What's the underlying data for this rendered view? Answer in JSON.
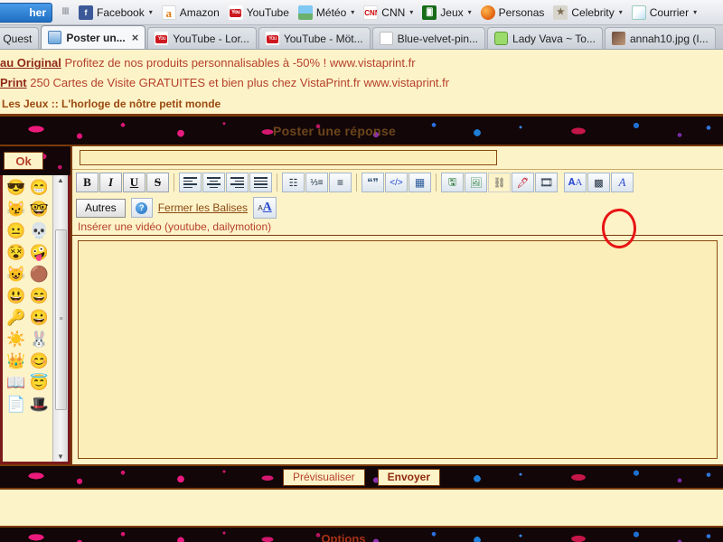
{
  "browser": {
    "bookmarks": [
      {
        "label": "her",
        "icon": "search-stub-icon",
        "has_caret": false
      },
      {
        "label": "Facebook",
        "icon": "facebook-icon",
        "glyph": "f",
        "has_caret": true
      },
      {
        "label": "Amazon",
        "icon": "amazon-icon",
        "glyph": "a",
        "has_caret": false
      },
      {
        "label": "YouTube",
        "icon": "youtube-icon",
        "glyph": "You",
        "has_caret": false
      },
      {
        "label": "Météo",
        "icon": "weather-icon",
        "glyph": "",
        "has_caret": true
      },
      {
        "label": "CNN",
        "icon": "cnn-icon",
        "glyph": "CNN",
        "has_caret": true
      },
      {
        "label": "Jeux",
        "icon": "games-icon",
        "glyph": "",
        "has_caret": true
      },
      {
        "label": "Personas",
        "icon": "firefox-icon",
        "glyph": "",
        "has_caret": false
      },
      {
        "label": "Celebrity",
        "icon": "star-icon",
        "glyph": "★",
        "has_caret": true
      },
      {
        "label": "Courrier",
        "icon": "mail-icon",
        "glyph": "",
        "has_caret": true
      }
    ],
    "tabs": [
      {
        "title": "ev - Quest",
        "icon": "page-icon",
        "active": false,
        "closable": false
      },
      {
        "title": "Poster un...",
        "icon": "monitor-icon",
        "active": true,
        "closable": true,
        "close_glyph": "×"
      },
      {
        "title": "YouTube - Lor...",
        "icon": "youtube-icon",
        "active": false,
        "closable": false
      },
      {
        "title": "YouTube - Möt...",
        "icon": "youtube-icon",
        "active": false,
        "closable": false
      },
      {
        "title": "Blue-velvet-pin...",
        "icon": "document-icon",
        "active": false,
        "closable": false
      },
      {
        "title": "Lady Vava ~ To...",
        "icon": "chat-icon",
        "active": false,
        "closable": false
      },
      {
        "title": "annah10.jpg (I...",
        "icon": "photo-icon",
        "active": false,
        "closable": false
      }
    ]
  },
  "ads": [
    {
      "strong": "au Original",
      "text": " Profitez de nos produits personnalisables à -50% !",
      "url": "www.vistaprint.fr"
    },
    {
      "strong": "Print",
      "text": " 250 Cartes de Visite GRATUITES et bien plus chez VistaPrint.fr",
      "url": "www.vistaprint.fr"
    }
  ],
  "breadcrumb": "Les Jeux :: L'horloge de nôtre petit monde",
  "page_header": "Poster une réponse",
  "smiley_panel": {
    "ok_button": "Ok",
    "smileys": [
      "😎",
      "😁",
      "😼",
      "🤓",
      "😐",
      "💀",
      "😵",
      "🤪",
      "😺",
      "🟤",
      "😃",
      "😄",
      "🔑",
      "😀",
      "☀️",
      "🐰",
      "👑",
      "😊",
      "📖",
      "😇",
      "📄",
      "🎩"
    ],
    "scroll_up": "▲",
    "scroll_down": "▼",
    "scroll_grip": "≡"
  },
  "editor": {
    "subject_value": "",
    "subject_placeholder": "",
    "message_value": "",
    "message_placeholder": "",
    "status_hint": "Insérer une vidéo (youtube, dailymotion)",
    "toolbar_row1": [
      {
        "name": "bold-button",
        "label": "B",
        "style": "plain-bold"
      },
      {
        "name": "italic-button",
        "label": "I",
        "style": "plain-italic"
      },
      {
        "name": "underline-button",
        "label": "U",
        "style": "plain-underline"
      },
      {
        "name": "strikethrough-button",
        "label": "S",
        "style": "plain-strike"
      },
      {
        "name": "separator-1",
        "label": "",
        "style": "sep"
      },
      {
        "name": "align-left-button",
        "label": "",
        "style": "align-left"
      },
      {
        "name": "align-center-button",
        "label": "",
        "style": "align-center"
      },
      {
        "name": "align-right-button",
        "label": "",
        "style": "align-right"
      },
      {
        "name": "align-justify-button",
        "label": "",
        "style": "align-justify"
      },
      {
        "name": "separator-2",
        "label": "",
        "style": "sep"
      },
      {
        "name": "bullet-list-button",
        "label": "☰",
        "style": "icon-list-bullet"
      },
      {
        "name": "numbered-list-button",
        "label": "☰",
        "style": "icon-list-number"
      },
      {
        "name": "indent-button",
        "label": "≡",
        "style": "icon-indent"
      },
      {
        "name": "separator-3",
        "label": "",
        "style": "sep"
      },
      {
        "name": "quote-button",
        "label": "💬",
        "style": "icon-quote"
      },
      {
        "name": "code-button",
        "label": "◇",
        "style": "icon-code"
      },
      {
        "name": "table-button",
        "label": "▦",
        "style": "icon-table"
      },
      {
        "name": "separator-4",
        "label": "",
        "style": "sep"
      },
      {
        "name": "upload-image-button",
        "label": "💾",
        "style": "icon-upload"
      },
      {
        "name": "insert-image-button",
        "label": "🖼",
        "style": "icon-image"
      },
      {
        "name": "insert-link-button",
        "label": "🔗",
        "style": "icon-link"
      },
      {
        "name": "flash-button",
        "label": "✒",
        "style": "icon-flash"
      },
      {
        "name": "insert-video-button",
        "label": "🎞",
        "style": "icon-video",
        "highlighted": true
      },
      {
        "name": "font-button",
        "label": "A",
        "style": "icon-font"
      },
      {
        "name": "color-button",
        "label": "▦",
        "style": "icon-color"
      },
      {
        "name": "font-style-button",
        "label": "A",
        "style": "icon-italic-a"
      }
    ],
    "toolbar_row2": {
      "autres_label": "Autres",
      "help_glyph": "?",
      "close_tags_label": "Fermer les Balises",
      "font_small": "A",
      "font_big": "A"
    }
  },
  "footer": {
    "preview_label": "Prévisualiser",
    "send_label": "Envoyer",
    "options_label": "Options"
  },
  "annotation": {
    "circle_target": "insert-video-button",
    "color": "#e81414"
  },
  "colors": {
    "page_bg": "#fdf3c9",
    "field_bg": "#fbeeb8",
    "border_brown": "#7a3a0a",
    "ad_text": "#b5402a",
    "link": "#8a4a12",
    "splatter_bg": "#120608",
    "annotation_red": "#e81414"
  }
}
